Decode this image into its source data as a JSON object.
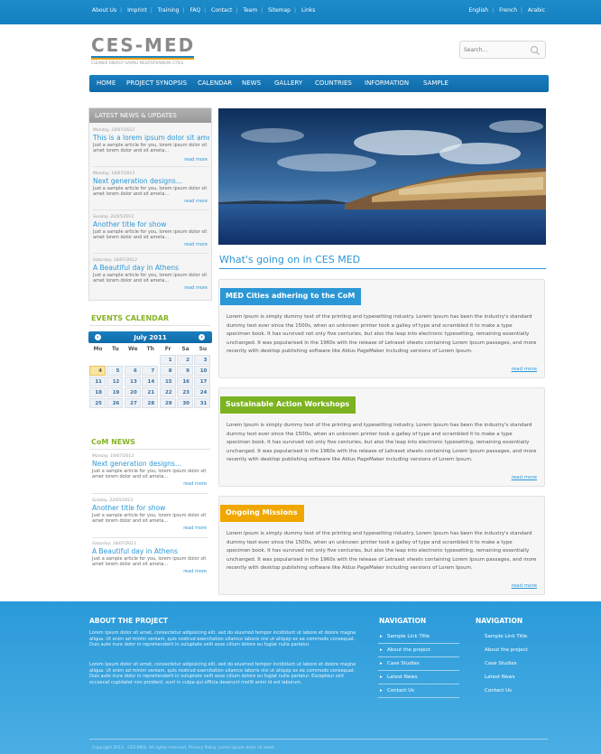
{
  "topbar": {
    "links": [
      "About Us",
      "Imprint",
      "Training",
      "FAQ",
      "Contact",
      "Team",
      "Sitemap",
      "Links"
    ],
    "languages": [
      "English",
      "French",
      "Arabic"
    ]
  },
  "header": {
    "logo": "CES-MED",
    "tagline": "CLEANER ENERGY SAVING MEDITERRANEAN CITIES",
    "search_placeholder": "Search..."
  },
  "nav": {
    "items": [
      "HOME",
      "PROJECT SYNOPSIS",
      "CALENDAR",
      "NEWS",
      "GALLERY",
      "COUNTRIES",
      "INFORMATION",
      "SAMPLE"
    ]
  },
  "latest": {
    "heading": "LATEST NEWS & UPDATES",
    "items": [
      {
        "date": "Monday, 18/07/2013",
        "title": "This is a lorem ipsum dolor sit amet",
        "desc": "Just a sample article for you, lorem ipsum dolor sit amet lorem dolor and sit ameta...",
        "more": "read more"
      },
      {
        "date": "Monday, 18/07/2013",
        "title": "Next generation designs...",
        "desc": "Just a sample article for you, lorem ipsum dolor sit amet lorem dolor and sit ameta...",
        "more": "read more"
      },
      {
        "date": "Sunday, 22/05/2013",
        "title": "Another title for show",
        "desc": "Just a sample article for you, lorem ipsum dolor sit amet lorem dolor and sit ameta...",
        "more": "read more"
      },
      {
        "date": "Saturday, 18/07/2013",
        "title": "A Beautiful day in Athens",
        "desc": "Just a sample article for you, lorem ipsum dolor sit amet lorem dolor and sit ameta...",
        "more": "read more"
      }
    ]
  },
  "events": {
    "heading": "EVENTS CALENDAR",
    "month": "July 2011",
    "dows": [
      "Mo",
      "Tu",
      "We",
      "Th",
      "Fr",
      "Sa",
      "Su"
    ],
    "weeks": [
      [
        "",
        "",
        "",
        "",
        "1",
        "2",
        "3"
      ],
      [
        "4",
        "5",
        "6",
        "7",
        "8",
        "9",
        "10"
      ],
      [
        "11",
        "12",
        "13",
        "14",
        "15",
        "16",
        "17"
      ],
      [
        "18",
        "19",
        "20",
        "21",
        "22",
        "23",
        "24"
      ],
      [
        "25",
        "26",
        "27",
        "28",
        "29",
        "30",
        "31"
      ]
    ],
    "today": "4"
  },
  "com_news": {
    "heading": "CoM NEWS",
    "items": [
      {
        "date": "Monday, 18/07/2013",
        "title": "Next generation designs...",
        "desc": "Just a sample article for you, lorem ipsum dolor sit amet lorem dolor and sit ameta...",
        "more": "read more"
      },
      {
        "date": "Sunday, 22/05/2013",
        "title": "Another title for show",
        "desc": "Just a sample article for you, lorem ipsum dolor sit amet lorem dolor and sit ameta...",
        "more": "read more"
      },
      {
        "date": "Saturday, 18/07/2013",
        "title": "A Beautiful day in Athens",
        "desc": "Just a sample article for you, lorem ipsum dolor sit amet lorem dolor and sit ameta...",
        "more": "read more"
      }
    ]
  },
  "main": {
    "title": "What's going on in CES MED",
    "cards": [
      {
        "tag": "MED Cities adhering to the CoM",
        "color": "#2c97d6",
        "body": "Lorem Ipsum is simply dummy text of the printing and typesetting industry. Lorem Ipsum has been the industry's standard dummy text ever since the 1500s, when an unknown printer took a galley of type and scrambled it to make a type specimen book. It has survived not only five centuries, but also the leap into electronic typesetting, remaining essentially unchanged. It was popularised in the 1960s with the release of Letraset sheets containing Lorem Ipsum passages, and more recently with desktop publishing software like Aldus PageMaker including versions of Lorem Ipsum.",
        "more": "read more"
      },
      {
        "tag": "Sustainable Action Workshops",
        "color": "#7cb320",
        "body": "Lorem Ipsum is simply dummy text of the printing and typesetting industry. Lorem Ipsum has been the industry's standard dummy text ever since the 1500s, when an unknown printer took a galley of type and scrambled it to make a type specimen book. It has survived not only five centuries, but also the leap into electronic typesetting, remaining essentially unchanged. It was popularised in the 1960s with the release of Letraset sheets containing Lorem Ipsum passages, and more recently with desktop publishing software like Aldus PageMaker including versions of Lorem Ipsum.",
        "more": "read more"
      },
      {
        "tag": "Ongoing Missions",
        "color": "#f0a800",
        "body": "Lorem Ipsum is simply dummy text of the printing and typesetting industry. Lorem Ipsum has been the industry's standard dummy text ever since the 1500s, when an unknown printer took a galley of type and scrambled it to make a type specimen book. It has survived not only five centuries, but also the leap into electronic typesetting, remaining essentially unchanged. It was popularised in the 1960s with the release of Letraset sheets containing Lorem Ipsum passages, and more recently with desktop publishing software like Aldus PageMaker including versions of Lorem Ipsum.",
        "more": "read more"
      }
    ]
  },
  "footer": {
    "about_heading": "ABOUT THE PROJECT",
    "about_p1": "Lorem ipsum dolor sit amet, consectetur adipisicing elit, sed do eiusmod tempor incididunt ut labore et dolore magna aliqua. Ut enim ad minim veniam, quis nostrud exercitation ullamco laboris nisi ut aliquip ex ea commodo consequat. Duis aute irure dolor in reprehenderit in voluptate velit esse cillum dolore eu fugiat nulla pariatur.",
    "about_p2": "Lorem ipsum dolor sit amet, consectetur adipisicing elit, sed do eiusmod tempor incididunt ut labore et dolore magna aliqua. Ut enim ad minim veniam, quis nostrud exercitation ullamco laboris nisi ut aliquip ex ea commodo consequat. Duis aute irure dolor in reprehenderit in voluptate velit esse cillum dolore eu fugiat nulla pariatur. Excepteur sint occaecat cupidatat non proident, sunt in culpa qui officia deserunt mollit anim id est laborum.",
    "nav1_heading": "NAVIGATION",
    "nav1": [
      "Sample Link Title",
      "About the project",
      "Case Studies",
      "Latest News",
      "Contact Us"
    ],
    "nav2_heading": "NAVIGATION",
    "nav2": [
      "Sample Link Title",
      "About the project",
      "Case Studies",
      "Latest News",
      "Contact Us"
    ],
    "copyright": "Copyright 2013 - CES-MED. All rights reserved. Privacy Policy. Lorem ipsum dolor sit amet."
  }
}
